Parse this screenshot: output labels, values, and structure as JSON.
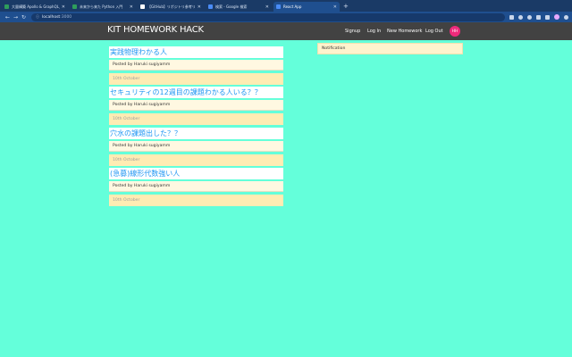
{
  "browser": {
    "tabs": [
      {
        "title": "大量構築 Apollo & GraphQL入門",
        "fav": "green"
      },
      {
        "title": "未来から来た Python 入門",
        "fav": "green"
      },
      {
        "title": "【GitHub】リポジトリ参考リンク集",
        "fav": "white"
      },
      {
        "title": "検索 - Google 検索",
        "fav": "blue"
      },
      {
        "title": "React App",
        "fav": "blue",
        "active": true
      }
    ],
    "url_host": "localhost",
    "url_port": ":3000"
  },
  "app": {
    "brand": "KIT HOMEWORK HACK",
    "nav": {
      "signup": "Signup",
      "login": "Log In",
      "new_homework": "New Homework",
      "logout": "Log Out"
    },
    "avatar_initials": "HH",
    "posts": [
      {
        "title": "実践物理わかる人",
        "author": "Posted by Haruki sugiyamm",
        "date": "10th October"
      },
      {
        "title": "セキュリティの12週目の課題わかる人いる？？",
        "author": "Posted by Haruki sugiyamm",
        "date": "10th October"
      },
      {
        "title": "穴水の課題出した？？",
        "author": "Posted by Haruki sugiyamm",
        "date": "10th October"
      },
      {
        "title": "(急募)線形代数強い人",
        "author": "Posted by Haruki sugiyamm",
        "date": "10th October"
      }
    ],
    "notification_title": "Notification"
  },
  "colors": {
    "page_bg": "#64ffda",
    "navbar_bg": "#424242",
    "title_text": "#2196f3",
    "avatar_bg": "#ee2a7b"
  }
}
